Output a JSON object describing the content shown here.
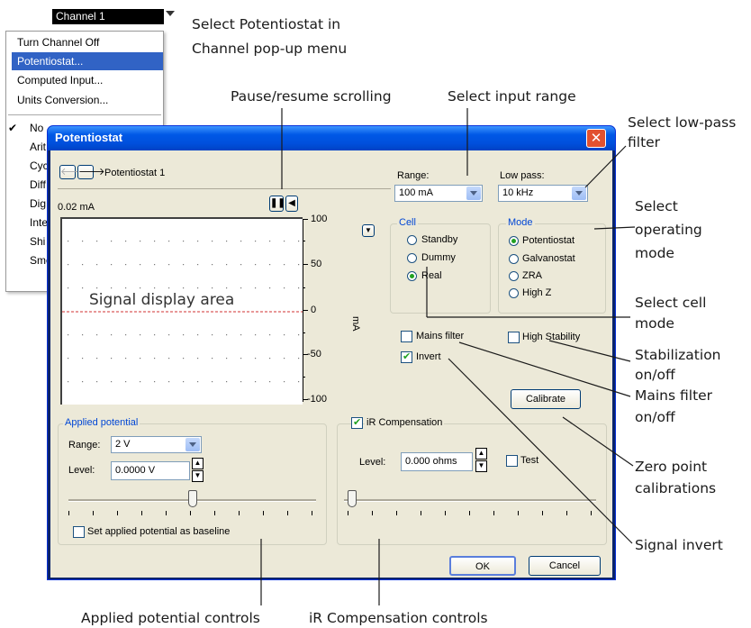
{
  "channel_menu": {
    "selected": "Channel 1",
    "items": [
      "Turn Channel Off",
      "Potentiostat...",
      "Computed Input...",
      "Units Conversion..."
    ],
    "highlighted_index": 1,
    "partial_items": [
      "No",
      "Arit",
      "Cyc",
      "Diff",
      "Dig",
      "Inte",
      "Shi",
      "Smo"
    ]
  },
  "dialog": {
    "title": "Potentiostat",
    "nav_label": "Potentiostat 1",
    "scale_label": "0.02 mA",
    "y_ticks": [
      "100",
      "50",
      "0",
      "-50",
      "-100"
    ],
    "unit": "mA",
    "signal_area_label": "Signal display area",
    "range_label": "Range:",
    "range_value": "100 mA",
    "lowpass_label": "Low pass:",
    "lowpass_value": "10 kHz",
    "cell": {
      "label": "Cell",
      "options": [
        "Standby",
        "Dummy",
        "Real"
      ],
      "selected": "Real"
    },
    "mode": {
      "label": "Mode",
      "options": [
        "Potentiostat",
        "Galvanostat",
        "ZRA",
        "High Z"
      ],
      "selected": "Potentiostat"
    },
    "mains_filter": {
      "label": "Mains filter",
      "checked": false
    },
    "high_stability": {
      "label": "High Stability",
      "checked": false
    },
    "invert": {
      "label": "Invert",
      "checked": true
    },
    "calibrate_label": "Calibrate",
    "applied_potential": {
      "label": "Applied potential",
      "range_label": "Range:",
      "range_value": "2 V",
      "level_label": "Level:",
      "level_value": "0.0000 V",
      "baseline_label": "Set applied potential as baseline",
      "baseline_checked": false
    },
    "ir_compensation": {
      "label": "iR Compensation",
      "checked": true,
      "level_label": "Level:",
      "level_value": "0.000 ohms",
      "test_label": "Test",
      "test_checked": false
    },
    "ok_label": "OK",
    "cancel_label": "Cancel"
  },
  "annotations": {
    "select_potentiostat_1": "Select Potentiostat in",
    "select_potentiostat_2": "Channel pop-up menu",
    "pause": "Pause/resume scrolling",
    "input_range": "Select input range",
    "lowpass_1": "Select low-pass",
    "lowpass_2": "filter",
    "op_mode_1": "Select",
    "op_mode_2": "operating",
    "op_mode_3": "mode",
    "cell_mode_1": "Select cell",
    "cell_mode_2": "mode",
    "stab_1": "Stabilization",
    "stab_2": "on/off",
    "mains_1": "Mains filter",
    "mains_2": "on/off",
    "zero_1": "Zero point",
    "zero_2": "calibrations",
    "signal_invert": "Signal invert",
    "applied_controls": "Applied potential controls",
    "ir_controls": "iR Compensation controls"
  }
}
